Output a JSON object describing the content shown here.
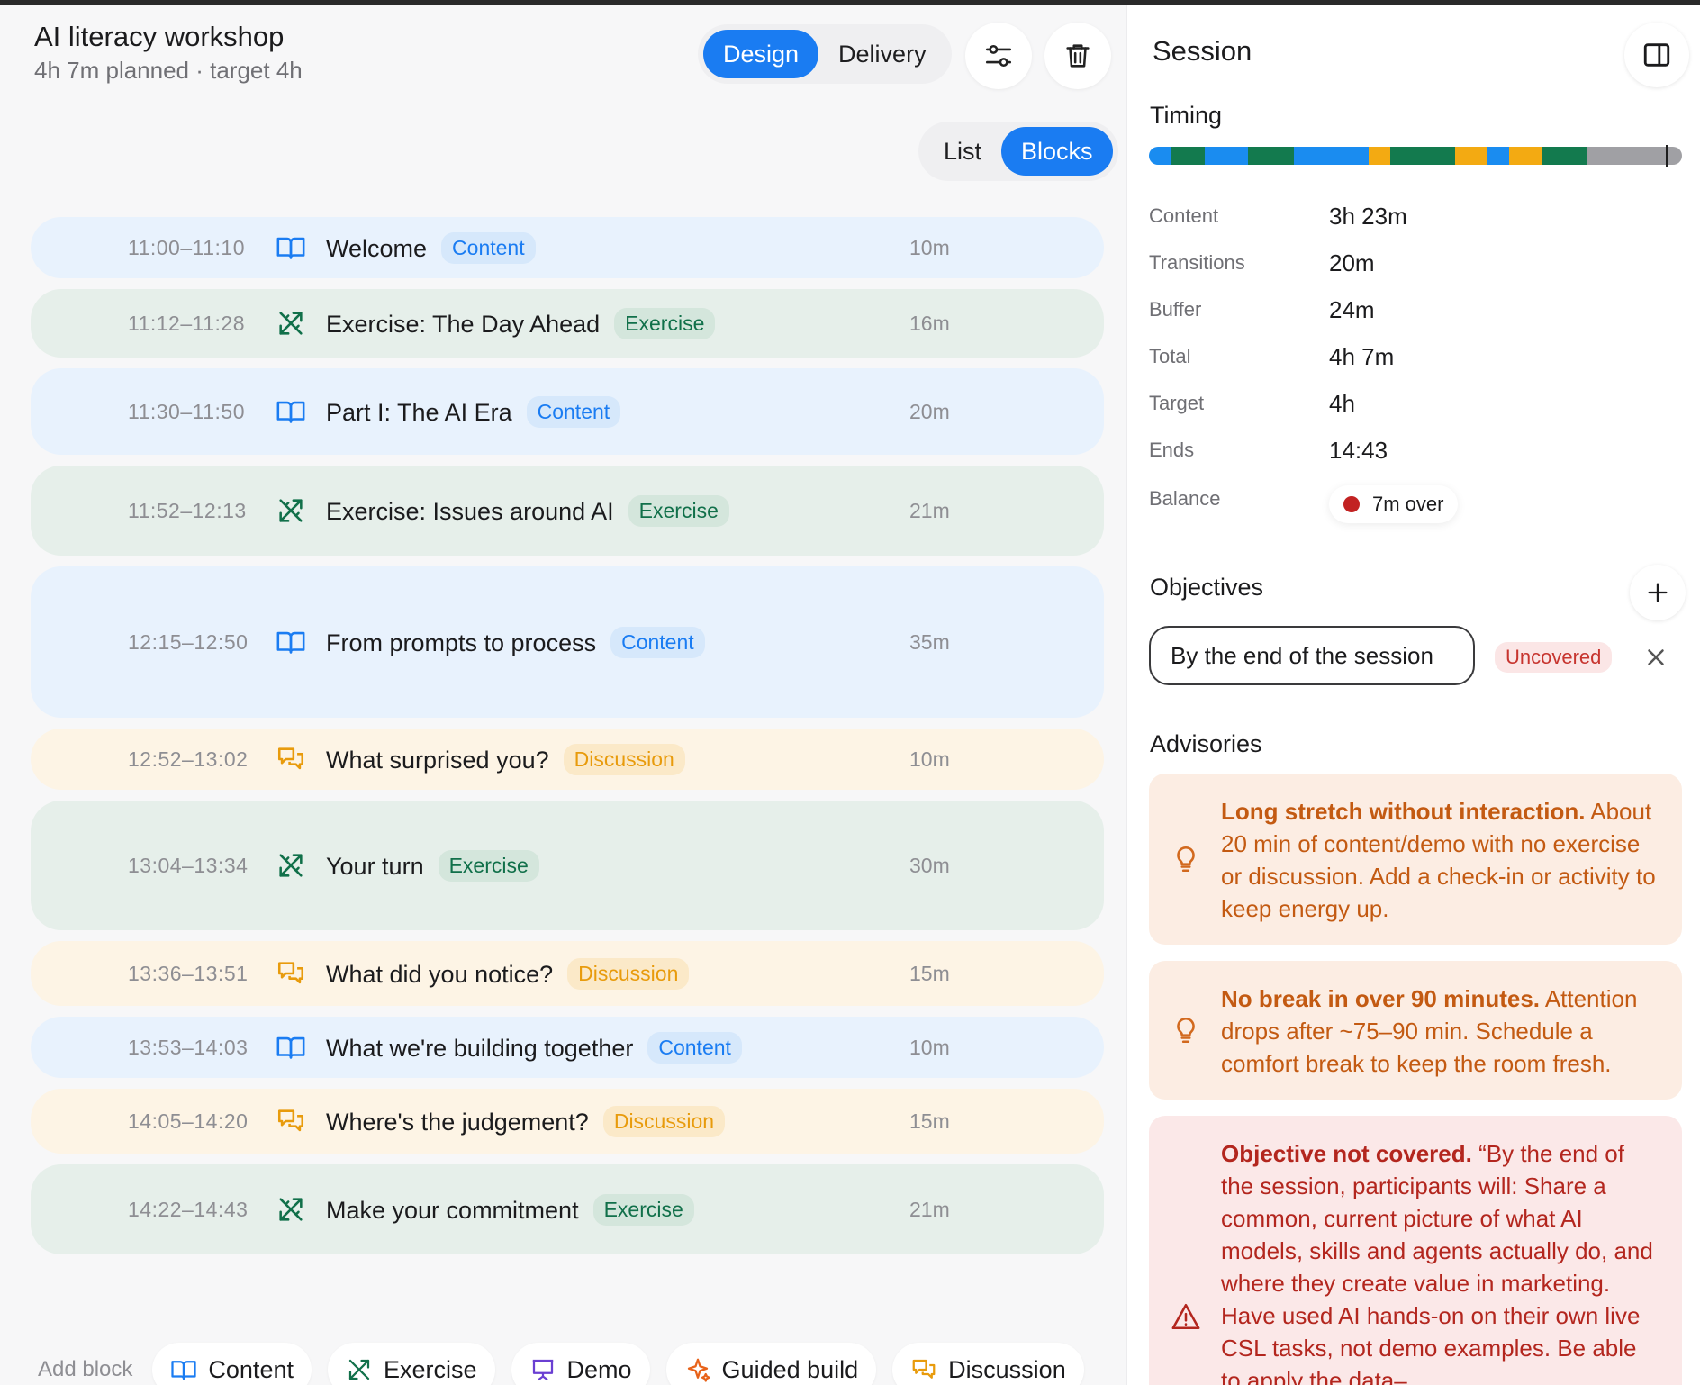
{
  "header": {
    "title": "AI literacy workshop",
    "subtitle": "4h 7m planned · target 4h"
  },
  "mode_toggle": {
    "design": "Design",
    "delivery": "Delivery",
    "active": "Design"
  },
  "view_toggle": {
    "list": "List",
    "blocks": "Blocks",
    "active": "Blocks"
  },
  "blocks": [
    {
      "time": "11:00–11:10",
      "name": "Welcome",
      "tag": "Content",
      "type": "content",
      "duration": "10m"
    },
    {
      "time": "11:12–11:28",
      "name": "Exercise: The Day Ahead",
      "tag": "Exercise",
      "type": "exercise",
      "duration": "16m"
    },
    {
      "time": "11:30–11:50",
      "name": "Part I: The AI Era",
      "tag": "Content",
      "type": "content",
      "duration": "20m"
    },
    {
      "time": "11:52–12:13",
      "name": "Exercise: Issues around AI",
      "tag": "Exercise",
      "type": "exercise",
      "duration": "21m"
    },
    {
      "time": "12:15–12:50",
      "name": "From prompts to process",
      "tag": "Content",
      "type": "content",
      "duration": "35m"
    },
    {
      "time": "12:52–13:02",
      "name": "What surprised you?",
      "tag": "Discussion",
      "type": "discussion",
      "duration": "10m"
    },
    {
      "time": "13:04–13:34",
      "name": "Your turn",
      "tag": "Exercise",
      "type": "exercise",
      "duration": "30m"
    },
    {
      "time": "13:36–13:51",
      "name": "What did you notice?",
      "tag": "Discussion",
      "type": "discussion",
      "duration": "15m"
    },
    {
      "time": "13:53–14:03",
      "name": "What we're building together",
      "tag": "Content",
      "type": "content",
      "duration": "10m"
    },
    {
      "time": "14:05–14:20",
      "name": "Where's the judgement?",
      "tag": "Discussion",
      "type": "discussion",
      "duration": "15m"
    },
    {
      "time": "14:22–14:43",
      "name": "Make your commitment",
      "tag": "Exercise",
      "type": "exercise",
      "duration": "21m"
    }
  ],
  "add_block": {
    "label": "Add block",
    "buttons": [
      {
        "label": "Content",
        "icon": "book-icon"
      },
      {
        "label": "Exercise",
        "icon": "tools-icon"
      },
      {
        "label": "Demo",
        "icon": "presentation-icon"
      },
      {
        "label": "Guided build",
        "icon": "sparkle-icon"
      },
      {
        "label": "Discussion",
        "icon": "chat-icon"
      }
    ]
  },
  "session": {
    "title": "Session",
    "timing": {
      "heading": "Timing",
      "segments": [
        {
          "type": "content",
          "minutes": 10
        },
        {
          "type": "exercise",
          "minutes": 16
        },
        {
          "type": "content",
          "minutes": 20
        },
        {
          "type": "exercise",
          "minutes": 21
        },
        {
          "type": "content",
          "minutes": 35
        },
        {
          "type": "discussion",
          "minutes": 10
        },
        {
          "type": "exercise",
          "minutes": 30
        },
        {
          "type": "discussion",
          "minutes": 15
        },
        {
          "type": "content",
          "minutes": 10
        },
        {
          "type": "discussion",
          "minutes": 15
        },
        {
          "type": "exercise",
          "minutes": 21
        },
        {
          "type": "other",
          "minutes": 44
        }
      ],
      "colors": {
        "content": "#1a8cf0",
        "exercise": "#137a4e",
        "discussion": "#f3aa12",
        "other": "#a0a0a4"
      }
    },
    "stats": [
      {
        "label": "Content",
        "value": "3h 23m"
      },
      {
        "label": "Transitions",
        "value": "20m"
      },
      {
        "label": "Buffer",
        "value": "24m"
      },
      {
        "label": "Total",
        "value": "4h 7m"
      },
      {
        "label": "Target",
        "value": "4h"
      },
      {
        "label": "Ends",
        "value": "14:43"
      }
    ],
    "balance": {
      "label": "Balance",
      "value": "7m over",
      "status_color": "#c22222"
    },
    "objectives": {
      "heading": "Objectives",
      "input_value": "By the end of the session",
      "status": "Uncovered"
    },
    "advisories": {
      "heading": "Advisories",
      "items": [
        {
          "title": "Long stretch without interaction.",
          "body": "About 20 min of content/demo with no exercise or discussion. Add a check-in or activity to keep energy up.",
          "level": "warn",
          "icon": "lightbulb-icon"
        },
        {
          "title": "No break in over 90 minutes.",
          "body": "Attention drops after ~75–90 min. Schedule a comfort break to keep the room fresh.",
          "level": "warn",
          "icon": "lightbulb-icon"
        },
        {
          "title": "Objective not covered.",
          "body": "“By the end of the session, participants will: Share a common, current picture of what AI models, skills and agents actually do, and where they create value in marketing. Have used AI hands-on on their own live CSL tasks, not demo examples. Be able to apply the data–",
          "level": "err",
          "icon": "warning-icon"
        }
      ]
    }
  }
}
